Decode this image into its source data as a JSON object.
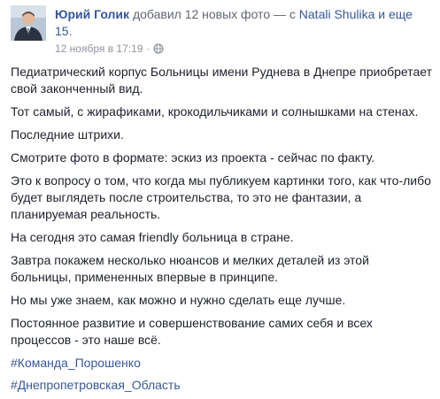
{
  "header": {
    "author": "Юрий Голик",
    "action": "добавил 12 новых фото",
    "separator": "— с",
    "tagged": "Natali Shulika",
    "and_more": "и еще 15",
    "period": "."
  },
  "meta": {
    "timestamp": "12 ноября в 17:19",
    "dot": "·",
    "privacy_icon": "globe-icon"
  },
  "paragraphs": [
    "Педиатрический корпус Больницы имени Руднева в Днепре приобретает свой законченный вид.",
    "Тот самый, с жирафиками, крокодильчиками и солнышками на стенах.",
    "Последние штрихи.",
    "Смотрите фото в формате: эскиз из проекта - сейчас по факту.",
    "Это к вопросу о том, что когда мы публикуем картинки того, как что-либо будет выглядеть после строительства, то это не фантазии, а планируемая реальность.",
    "На сегодня это самая friendly больница в стране.",
    "Завтра покажем несколько нюансов и мелких деталей из этой больницы, примененных впервые в принципе.",
    "Но мы уже знаем, как можно и нужно сделать еще лучше.",
    "Постоянное развитие и совершенствование самих себя и всех процессов - это наше всё."
  ],
  "hashtags": [
    "#Команда_Порошенко",
    "#Днепропетровская_Область"
  ],
  "colors": {
    "link": "#365899",
    "text": "#1d2129",
    "meta": "#90949c"
  }
}
